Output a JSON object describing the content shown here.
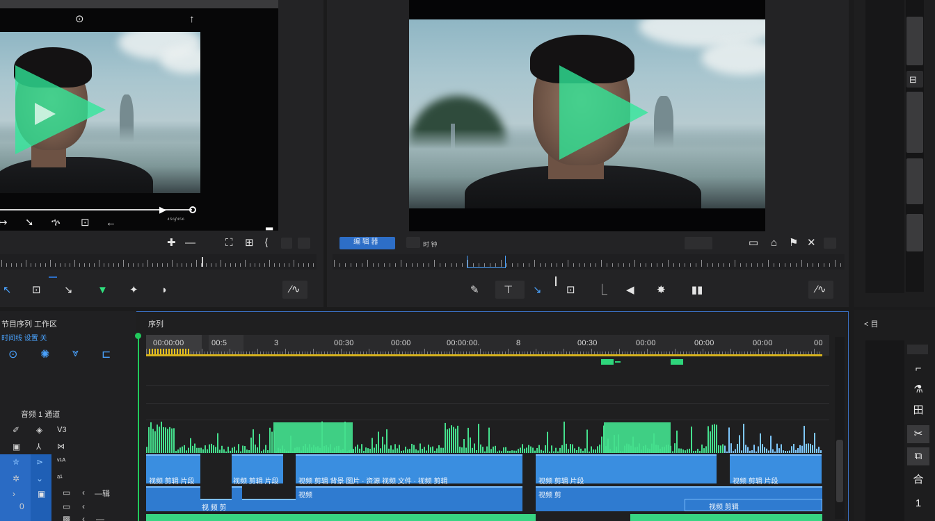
{
  "source_monitor": {
    "timecode_label": "⁴⁵⁶/⁴⁵⁶",
    "top_icon_left": "⊙",
    "top_icon_right": "↑",
    "controls": [
      "↦",
      "➘",
      "ኍ",
      "⊡",
      "←"
    ],
    "end_marker": "▂",
    "toolbar_right": [
      "✚",
      "—",
      "⛶",
      "⊞",
      "⟨",
      "▢"
    ],
    "tools": [
      "↖",
      "⊡",
      "↘",
      "▼",
      "✦",
      "◗"
    ],
    "graph_btn": "⁄∿"
  },
  "program_monitor": {
    "button_label": "编 辑 器",
    "small_label": "时 钟",
    "tools": [
      "✎",
      "⊤",
      "↘",
      "⊡",
      "⎿",
      "◀",
      "✸",
      "▮▮"
    ],
    "toolbar_right": [
      "▭",
      "⌂",
      "⚑",
      "▢"
    ],
    "graph_btn": "⁄∿"
  },
  "right_panel": {
    "top_icon": "⊟",
    "label": "< 目",
    "tools": [
      "⌐",
      "⚗",
      "田",
      "✂",
      "⧉",
      "合",
      "1"
    ]
  },
  "timeline": {
    "left_title": "节目序列 工作区",
    "left_subtitle": "时间线 设置 关",
    "header_label": "序列",
    "section_label": "音频 1 通道",
    "track_labels": [
      "Ⅴ3",
      "⋈",
      "ᵛ¹ᴬ",
      "ᵃ¹",
      "—辑"
    ],
    "ruler_numbers": [
      "00:00:00",
      "00:5",
      "3",
      "00:30",
      "00:00",
      "00:00:00.",
      "8",
      "00:30",
      "00:00",
      "00:00",
      "00:00",
      "00"
    ],
    "clip_labels": [
      "视频 剪辑 片段",
      "视频 剪辑 片段",
      "视频 剪辑 背景 图片 · 资源 视频 文件 · 视频 剪辑",
      "视频 剪辑 片段",
      "视频 剪辑",
      "视 频 剪",
      "视频",
      "视频 剪",
      "视频 剪辑 片段"
    ]
  },
  "colors": {
    "accent_blue": "#2d6ec7",
    "clip_blue": "#3a8ee0",
    "audio_green": "#38d482",
    "playhead_green": "#21c95c",
    "work_area_yellow": "#d7b21d"
  }
}
